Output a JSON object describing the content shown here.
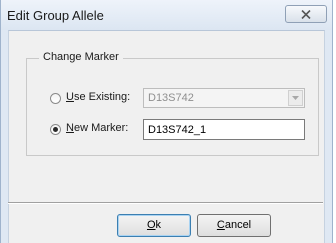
{
  "window": {
    "title": "Edit Group Allele"
  },
  "group": {
    "legend": "Change Marker"
  },
  "options": {
    "use_existing": {
      "mnemonic": "U",
      "rest": "se Existing:",
      "checked": false
    },
    "new_marker": {
      "mnemonic": "N",
      "rest": "ew Marker:",
      "checked": true
    }
  },
  "existing_combo": {
    "value": "D13S742",
    "enabled": false
  },
  "new_marker_field": {
    "value": "D13S742_1"
  },
  "buttons": {
    "ok": {
      "mnemonic": "O",
      "rest": "k"
    },
    "cancel": {
      "mnemonic": "C",
      "rest": "ancel"
    }
  },
  "icons": {
    "close": "close-icon",
    "dropdown": "chevron-down-icon"
  },
  "colors": {
    "frame": "#dfe8f3",
    "client": "#f0f0f0",
    "default_button_border": "#3c7fb1"
  }
}
